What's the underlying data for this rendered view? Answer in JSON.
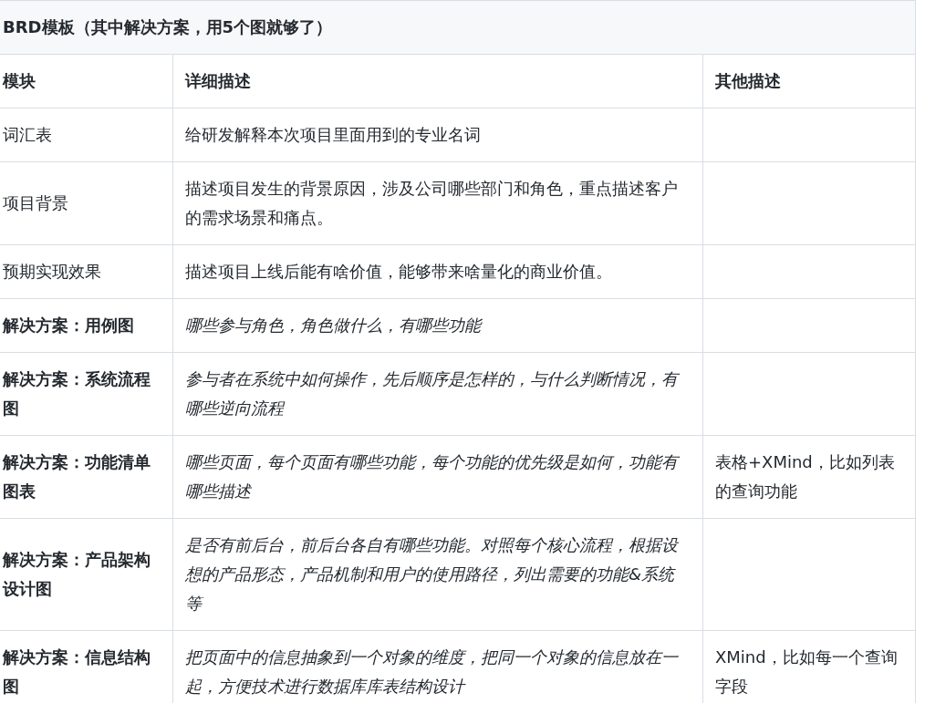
{
  "title": "BRD模板（其中解决方案，用5个图就够了）",
  "columns": [
    "模块",
    "详细描述",
    "其他描述"
  ],
  "rows": [
    {
      "kind": "plain",
      "module": "词汇表",
      "detail": "给研发解释本次项目里面用到的专业名词"
    },
    {
      "kind": "plain",
      "module": "项目背景",
      "detail": "描述项目发生的背景原因，涉及公司哪些部门和角色，重点描述客户的需求场景和痛点。"
    },
    {
      "kind": "plain",
      "module": "预期实现效果",
      "detail": "描述项目上线后能有啥价值，能够带来啥量化的商业价值。"
    },
    {
      "kind": "solution",
      "module": "解决方案：用例图",
      "detail": "哪些参与角色，角色做什么，有哪些功能"
    },
    {
      "kind": "solution",
      "module": "解决方案：系统流程图",
      "detail": "参与者在系统中如何操作，先后顺序是怎样的，与什么判断情况，有哪些逆向流程"
    },
    {
      "kind": "solution",
      "module": "解决方案：功能清单图表",
      "detail": "哪些页面，每个页面有哪些功能，每个功能的优先级是如何，功能有哪些描述",
      "other": "表格+XMind，比如列表的查询功能"
    },
    {
      "kind": "solution",
      "module": "解决方案：产品架构设计图",
      "detail": "是否有前后台，前后台各自有哪些功能。对照每个核心流程，根据设想的产品形态，产品机制和用户的使用路径，列出需要的功能&系统等"
    },
    {
      "kind": "solution",
      "module": "解决方案：信息结构图",
      "detail": "把页面中的信息抽象到一个对象的维度，把同一个对象的信息放在一起，方便技术进行数据库库表结构设计",
      "other": "XMind，比如每一个查询字段"
    }
  ]
}
